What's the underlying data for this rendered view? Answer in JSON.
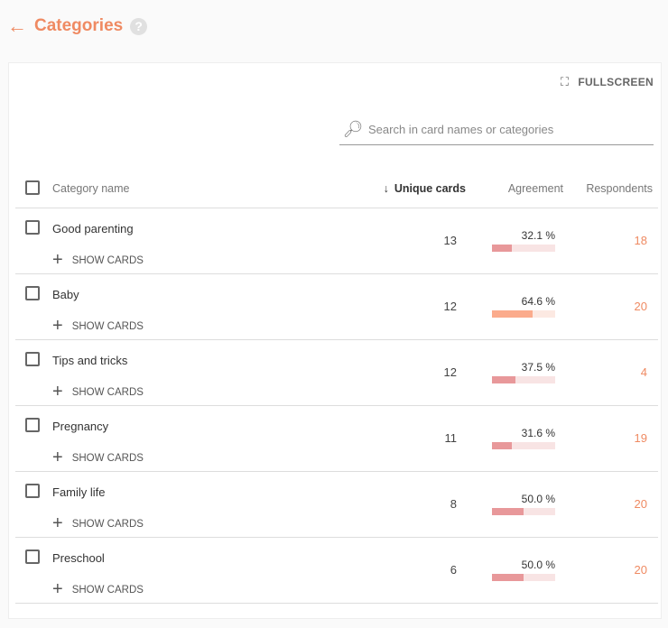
{
  "header": {
    "title": "Categories",
    "back_icon": "arrow-left-icon",
    "help": "?"
  },
  "toolbar": {
    "fullscreen_label": "FULLSCREEN",
    "search_placeholder": "Search in card names or categories"
  },
  "table": {
    "columns": {
      "name": "Category name",
      "unique": "Unique cards",
      "agreement": "Agreement",
      "respondents": "Respondents"
    },
    "show_cards_label": "SHOW CARDS",
    "rows": [
      {
        "name": "Good parenting",
        "unique": "13",
        "agreement": "32.1 %",
        "agreement_value": 32.1,
        "respondents": "18"
      },
      {
        "name": "Baby",
        "unique": "12",
        "agreement": "64.6 %",
        "agreement_value": 64.6,
        "respondents": "20"
      },
      {
        "name": "Tips and tricks",
        "unique": "12",
        "agreement": "37.5 %",
        "agreement_value": 37.5,
        "respondents": "4"
      },
      {
        "name": "Pregnancy",
        "unique": "11",
        "agreement": "31.6 %",
        "agreement_value": 31.6,
        "respondents": "19"
      },
      {
        "name": "Family life",
        "unique": "8",
        "agreement": "50.0 %",
        "agreement_value": 50.0,
        "respondents": "20"
      },
      {
        "name": "Preschool",
        "unique": "6",
        "agreement": "50.0 %",
        "agreement_value": 50.0,
        "respondents": "20"
      }
    ]
  },
  "colors": {
    "accent": "#ef8a62",
    "bar_low": "#e8989a",
    "bar_low_bg": "#f8e4e4",
    "bar_high": "#fbab8c",
    "bar_high_bg": "#fce9e2"
  }
}
